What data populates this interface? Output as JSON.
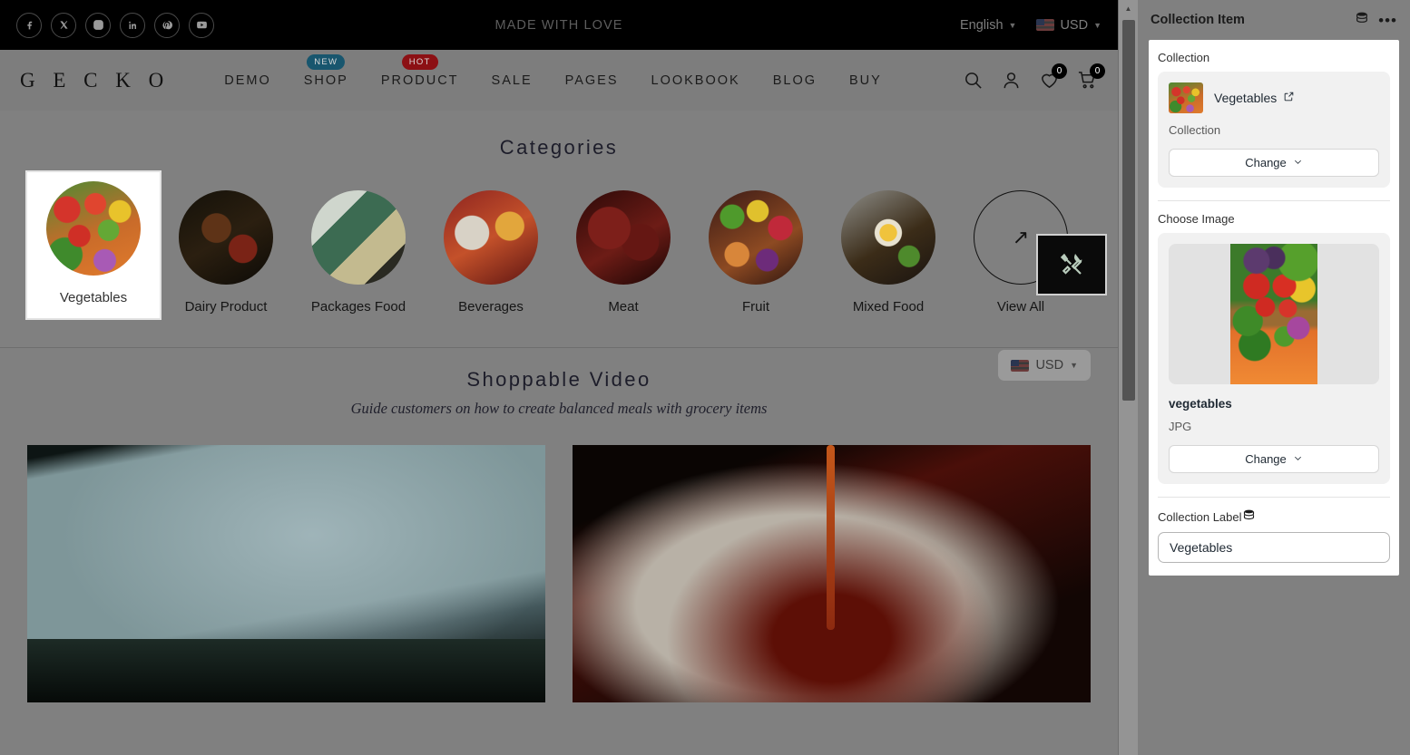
{
  "site": {
    "topbar": {
      "banner_text": "MADE WITH LOVE",
      "language": "English",
      "currency": "USD",
      "social": [
        {
          "name": "facebook-icon",
          "glyph": "f"
        },
        {
          "name": "x-twitter-icon",
          "glyph": "X"
        },
        {
          "name": "instagram-icon",
          "glyph": "IG"
        },
        {
          "name": "linkedin-icon",
          "glyph": "in"
        },
        {
          "name": "pinterest-icon",
          "glyph": "P"
        },
        {
          "name": "youtube-icon",
          "glyph": "Y"
        }
      ]
    },
    "nav": {
      "logo": "G E C K O",
      "links": [
        {
          "label": "DEMO",
          "tag": ""
        },
        {
          "label": "SHOP",
          "tag": "NEW"
        },
        {
          "label": "PRODUCT",
          "tag": "HOT"
        },
        {
          "label": "SALE",
          "tag": ""
        },
        {
          "label": "PAGES",
          "tag": ""
        },
        {
          "label": "LOOKBOOK",
          "tag": ""
        },
        {
          "label": "BLOG",
          "tag": ""
        },
        {
          "label": "BUY",
          "tag": ""
        }
      ],
      "wishlist_count": "0",
      "cart_count": "0"
    },
    "categories": {
      "title": "Categories",
      "items": [
        {
          "label": "Vegetables",
          "art": "art-veg",
          "selected": true
        },
        {
          "label": "Dairy Product",
          "art": "art-dairy",
          "selected": false
        },
        {
          "label": "Packages Food",
          "art": "art-pack",
          "selected": false
        },
        {
          "label": "Beverages",
          "art": "art-bev",
          "selected": false
        },
        {
          "label": "Meat",
          "art": "art-meat",
          "selected": false
        },
        {
          "label": "Fruit",
          "art": "art-fruit",
          "selected": false
        },
        {
          "label": "Mixed Food",
          "art": "art-mixed",
          "selected": false
        },
        {
          "label": "View All",
          "art": "",
          "selected": false
        }
      ],
      "view_all_arrow": "↗"
    },
    "video_section": {
      "title": "Shoppable Video",
      "subtitle": "Guide customers on how to create balanced meals with grocery items",
      "currency": "USD"
    }
  },
  "panel": {
    "title": "Collection Item",
    "collection": {
      "label": "Collection",
      "item_name": "Vegetables",
      "item_type": "Collection",
      "change_label": "Change"
    },
    "image": {
      "label": "Choose Image",
      "file_name": "vegetables",
      "file_format": "JPG",
      "change_label": "Change"
    },
    "collection_label": {
      "label": "Collection Label",
      "value": "Vegetables"
    }
  },
  "colors": {
    "badge_new": "#18566e",
    "badge_hot": "#8c1014",
    "panel_bg": "#ffffff",
    "card_bg": "#f1f1f1"
  }
}
